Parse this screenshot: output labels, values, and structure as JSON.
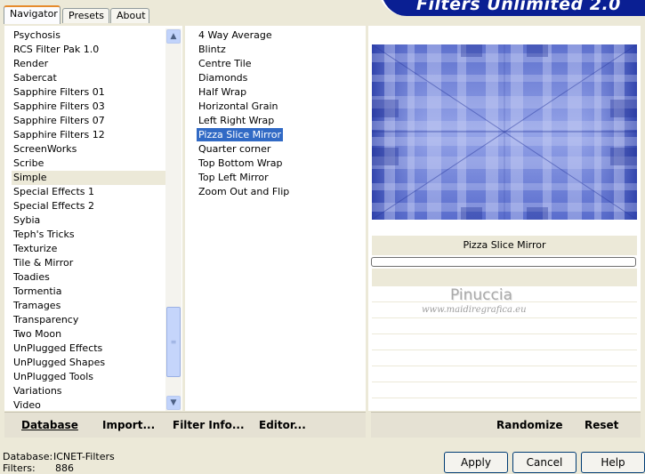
{
  "tabs": [
    {
      "label": "Navigator"
    },
    {
      "label": "Presets"
    },
    {
      "label": "About"
    }
  ],
  "banner": {
    "title": "Filters Unlimited 2.0"
  },
  "categories": [
    "Psychosis",
    "RCS Filter Pak 1.0",
    "Render",
    "Sabercat",
    "Sapphire Filters 01",
    "Sapphire Filters 03",
    "Sapphire Filters 07",
    "Sapphire Filters 12",
    "ScreenWorks",
    "Scribe",
    "Simple",
    "Special Effects 1",
    "Special Effects 2",
    "Sybia",
    "Teph's Tricks",
    "Texturize",
    "Tile & Mirror",
    "Toadies",
    "Tormentia",
    "Tramages",
    "Transparency",
    "Two Moon",
    "UnPlugged Effects",
    "UnPlugged Shapes",
    "UnPlugged Tools",
    "Variations",
    "Video"
  ],
  "selected_category": "Simple",
  "filters": [
    "4 Way Average",
    "Blintz",
    "Centre Tile",
    "Diamonds",
    "Half Wrap",
    "Horizontal Grain",
    "Left Right Wrap",
    "Pizza Slice Mirror",
    "Quarter corner",
    "Top Bottom Wrap",
    "Top Left Mirror",
    "Zoom Out and Flip"
  ],
  "selected_filter": "Pizza Slice Mirror",
  "left_bar": {
    "database": "Database",
    "import": "Import...",
    "filter_info": "Filter Info...",
    "editor": "Editor..."
  },
  "right_bar": {
    "randomize": "Randomize",
    "reset": "Reset"
  },
  "preview": {
    "filter_name": "Pizza Slice Mirror"
  },
  "watermark": {
    "name": "Pinuccia",
    "url": "www.maidiregrafica.eu"
  },
  "footer": {
    "database_label": "Database:",
    "database_value": "ICNET-Filters",
    "filters_label": "Filters:",
    "filters_value": "886"
  },
  "buttons": {
    "apply": "Apply",
    "cancel": "Cancel",
    "help": "Help"
  },
  "colors": {
    "selection": "#316ac5",
    "banner": "#0a1f93",
    "preview_base": "#6b7fd6"
  }
}
